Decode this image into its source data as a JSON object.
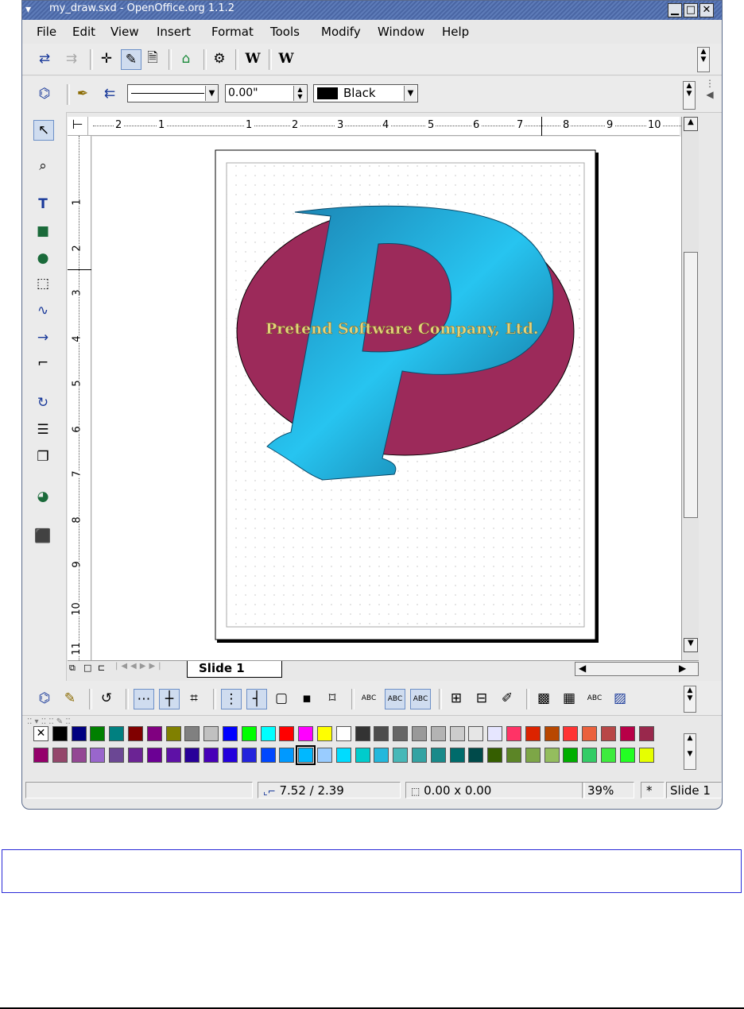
{
  "window": {
    "title": "my_draw.sxd - OpenOffice.org 1.1.2"
  },
  "menu": [
    {
      "label": "File",
      "id": "file"
    },
    {
      "label": "Edit",
      "id": "edit"
    },
    {
      "label": "View",
      "id": "view"
    },
    {
      "label": "Insert",
      "id": "insert"
    },
    {
      "label": "Format",
      "id": "format"
    },
    {
      "label": "Tools",
      "id": "tools"
    },
    {
      "label": "Modify",
      "id": "modify"
    },
    {
      "label": "Window",
      "id": "window"
    },
    {
      "label": "Help",
      "id": "help"
    }
  ],
  "line_toolbar": {
    "width_value": "0.00\"",
    "color_name": "Black",
    "color_hex": "#000000"
  },
  "ruler": {
    "top_labels": [
      "2",
      "1",
      "1",
      "2",
      "3",
      "4",
      "5",
      "6",
      "7",
      "8",
      "9",
      "10"
    ],
    "left_labels": [
      "1",
      "2",
      "3",
      "4",
      "5",
      "6",
      "7",
      "8",
      "9",
      "10",
      "11"
    ]
  },
  "drawing": {
    "logo_text": "Pretend Software Company, Ltd.",
    "ellipse_color": "#9c2a5a",
    "letter_color": "#1aa0d8"
  },
  "tabs": {
    "active": "Slide 1"
  },
  "status": {
    "position": "7.52 / 2.39",
    "size": "0.00 x 0.00",
    "zoom": "39%",
    "modified": "*",
    "page": "Slide 1"
  },
  "palette": {
    "row1": [
      "none",
      "#000000",
      "#000080",
      "#008000",
      "#008080",
      "#800000",
      "#800080",
      "#808000",
      "#808080",
      "#c0c0c0",
      "#0000ff",
      "#00ff00",
      "#00ffff",
      "#ff0000",
      "#ff00ff",
      "#ffff00",
      "#ffffff",
      "#333333",
      "#4d4d4d",
      "#666666",
      "#999999",
      "#b3b3b3",
      "#cccccc",
      "#e6e6e6",
      "#e6e6ff",
      "#ff3366",
      "#dc2300",
      "#b84700",
      "#ff3333",
      "#eb613d",
      "#b84747",
      "#b80047",
      "#99284c"
    ],
    "row2": [
      "#94006b",
      "#94476b",
      "#944794",
      "#9966cc",
      "#6b4794",
      "#6b2394",
      "#6b0094",
      "#5e11a6",
      "#280099",
      "#4700b8",
      "#2300dc",
      "#2323dc",
      "#0047ff",
      "#0099ff",
      "#00b8ff",
      "#99ccff",
      "#00dcff",
      "#00cccc",
      "#23b8dc",
      "#47b8b8",
      "#33a3a3",
      "#198a8a",
      "#006b6b",
      "#004a4a",
      "#355e00",
      "#5c8526",
      "#7da647",
      "#94bd5e",
      "#00ae00",
      "#33cc66",
      "#3deb3d",
      "#23ff23",
      "#e6ff00"
    ],
    "selected_index": 14
  }
}
